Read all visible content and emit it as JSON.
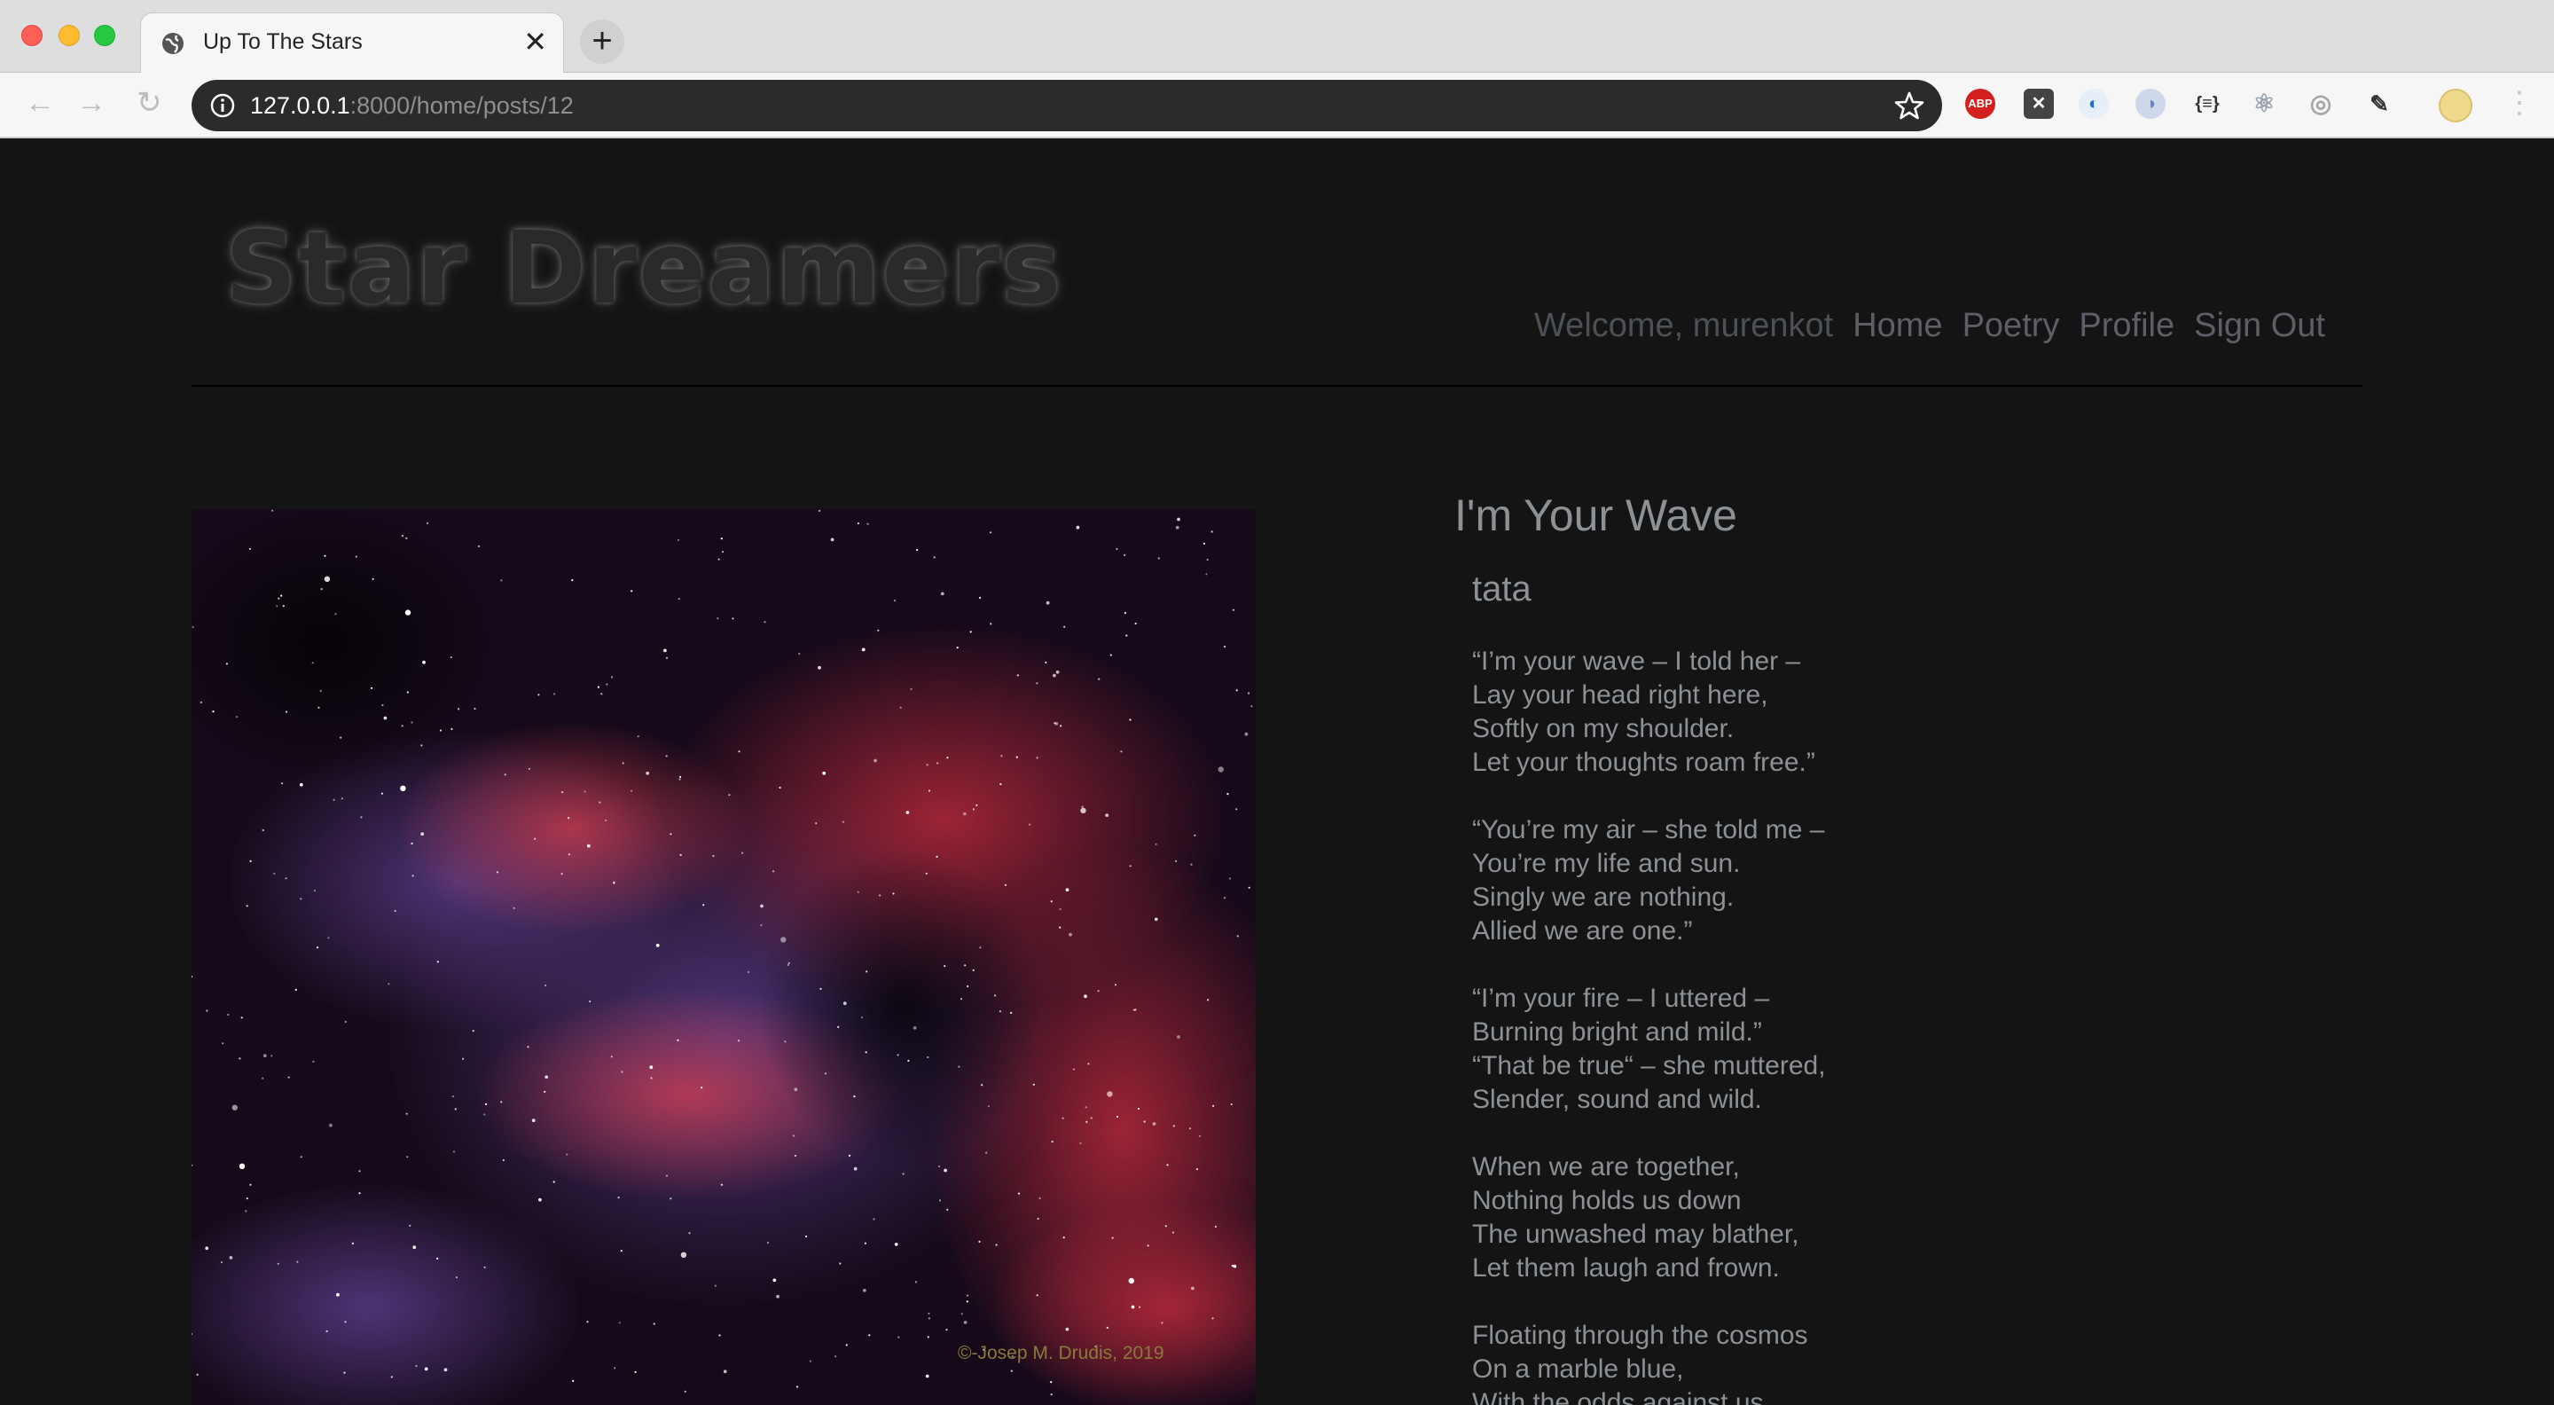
{
  "browser": {
    "tab_title": "Up To The Stars",
    "tab_close": "✕",
    "new_tab": "+",
    "url_host": "127.0.0.1",
    "url_rest": ":8000/home/posts/12",
    "back": "←",
    "forward": "→",
    "reload": "↻",
    "extensions": [
      {
        "icon": "adblock-plus-icon",
        "label": "ABP"
      },
      {
        "icon": "x-extension-icon",
        "label": "✕"
      },
      {
        "icon": "compass-icon",
        "label": "◐"
      },
      {
        "icon": "circle-extension-icon",
        "label": "◑"
      },
      {
        "icon": "json-braces-icon",
        "label": "{≡}"
      },
      {
        "icon": "react-devtools-icon",
        "label": "⚛"
      },
      {
        "icon": "target-extension-icon",
        "label": "◎"
      },
      {
        "icon": "eyedropper-icon",
        "label": "✎"
      }
    ],
    "menu": "⋮"
  },
  "site": {
    "brand": "Star Dreamers",
    "nav": {
      "welcome": "Welcome, murenkot",
      "items": [
        "Home",
        "Poetry",
        "Profile",
        "Sign Out"
      ]
    }
  },
  "post": {
    "image_credit": "©-Josep M. Drudis, 2019",
    "title": "I'm Your Wave",
    "author": "tata",
    "stanzas": [
      [
        "“I’m your wave – I told her –",
        "Lay your head right here,",
        "Softly on my shoulder.",
        "Let your thoughts roam free.”"
      ],
      [
        "“You’re my air – she told me –",
        "You’re my life and sun.",
        "Singly we are nothing.",
        "Allied we are one.”"
      ],
      [
        "“I’m your fire – I uttered –",
        "Burning bright and mild.”",
        "“That be true“ – she muttered,",
        "Slender, sound and wild."
      ],
      [
        "When we are together,",
        "Nothing holds us down",
        "The unwashed may blather,",
        "Let them laugh and frown."
      ],
      [
        "Floating through the cosmos",
        "On a marble blue,",
        "With the odds against us"
      ]
    ]
  },
  "colors": {
    "page_bg": "#141414",
    "text": "#8c9196",
    "nav_text": "#5c6066"
  }
}
